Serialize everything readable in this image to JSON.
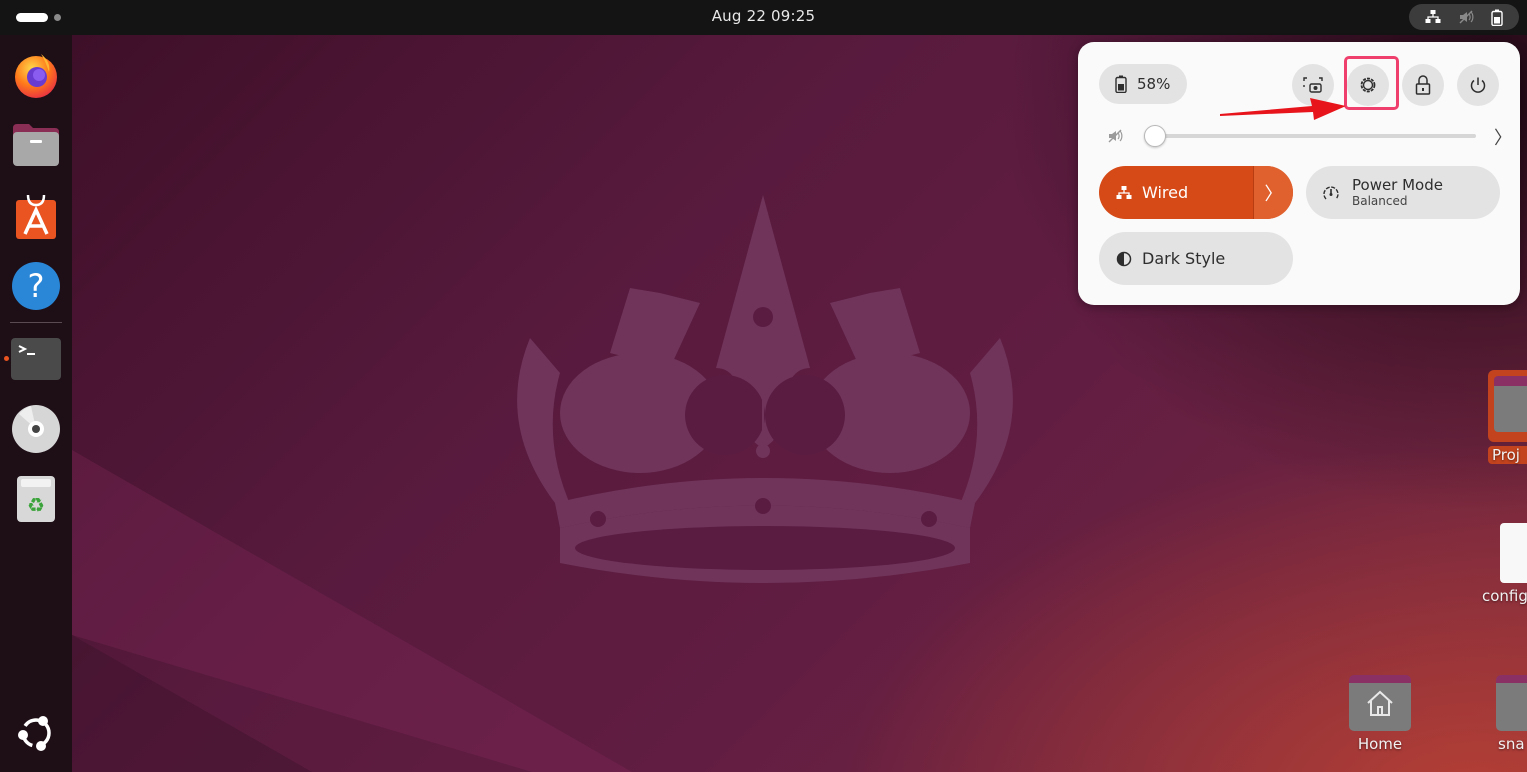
{
  "topbar": {
    "clock": "Aug 22  09:25",
    "status_icons": [
      "network-wired-icon",
      "volume-muted-icon",
      "battery-icon"
    ]
  },
  "dock": {
    "items": [
      {
        "name": "Firefox",
        "icon": "firefox-icon"
      },
      {
        "name": "Files",
        "icon": "files-icon"
      },
      {
        "name": "App Center",
        "icon": "app-center-icon"
      },
      {
        "name": "Help",
        "icon": "help-icon"
      },
      {
        "name": "Terminal",
        "icon": "terminal-icon",
        "running": true
      },
      {
        "name": "Disc",
        "icon": "optical-disc-icon"
      },
      {
        "name": "Trash",
        "icon": "trash-icon"
      }
    ],
    "show_apps_icon": "ubuntu-logo-icon"
  },
  "desktop_icons": [
    {
      "label": "Proj",
      "type": "folder",
      "selected": true
    },
    {
      "label": "config",
      "type": "file"
    },
    {
      "label": "Home",
      "type": "home-folder"
    },
    {
      "label": "sna",
      "type": "folder"
    }
  ],
  "quick_settings": {
    "battery_label": "58%",
    "buttons": [
      "screenshot-icon",
      "settings-icon",
      "lock-icon",
      "power-icon"
    ],
    "volume": {
      "muted": true,
      "level": 0
    },
    "wired": {
      "label": "Wired",
      "active": true
    },
    "power_mode": {
      "title": "Power Mode",
      "subtitle": "Balanced"
    },
    "dark_style": {
      "label": "Dark Style",
      "active": false
    },
    "highlight_target": "settings-button"
  },
  "colors": {
    "accent": "#d54a17",
    "highlight": "#ef3f6c",
    "annotation_arrow": "#e8141c"
  }
}
